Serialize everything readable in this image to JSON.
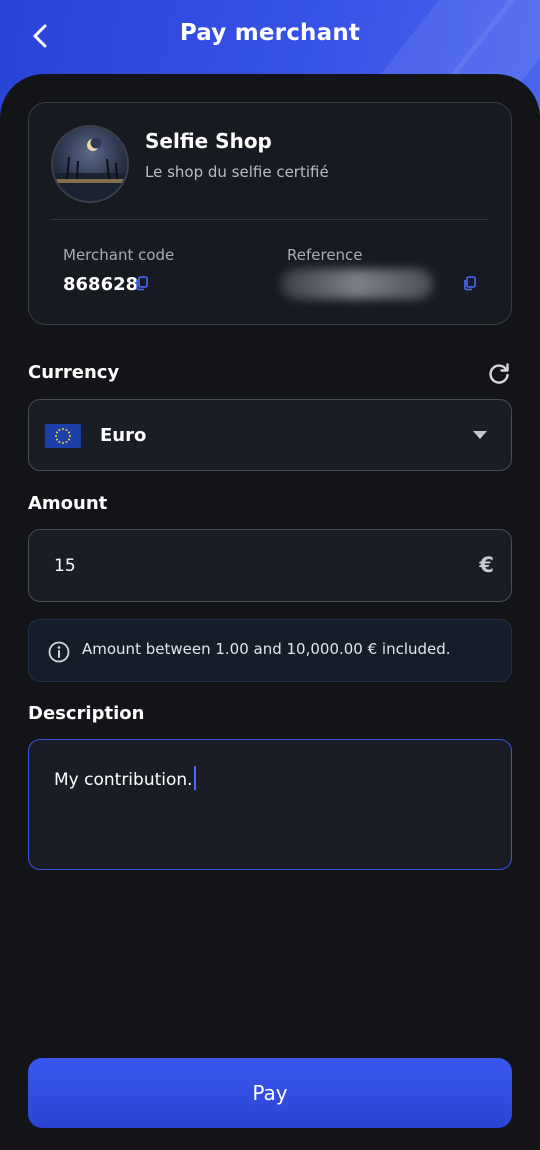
{
  "header": {
    "title": "Pay merchant",
    "back_icon": "chevron-left-icon"
  },
  "merchant": {
    "name": "Selfie Shop",
    "tagline": "Le shop du selfie certifié",
    "code_label": "Merchant code",
    "code_value": "868628",
    "reference_label": "Reference",
    "copy_icon": "copy-icon"
  },
  "currency": {
    "label": "Currency",
    "selected": "Euro",
    "flag_icon": "eu-flag-icon",
    "refresh_icon": "refresh-icon"
  },
  "amount": {
    "label": "Amount",
    "value": "15",
    "unit": "€",
    "info": "Amount between 1.00 and 10,000.00 € included."
  },
  "description": {
    "label": "Description",
    "value": "My contribution."
  },
  "pay_button": {
    "label": "Pay"
  },
  "colors": {
    "accent": "#3651e6",
    "background": "#121418",
    "card": "#171a20"
  }
}
